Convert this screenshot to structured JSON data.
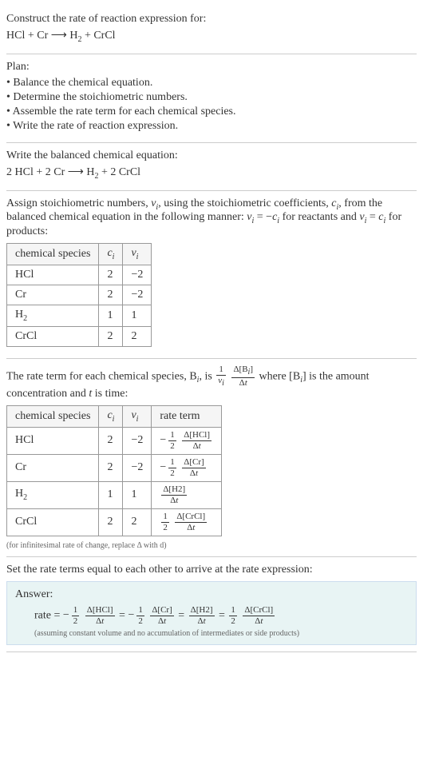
{
  "header": {
    "prompt": "Construct the rate of reaction expression for:",
    "equation_lhs": "HCl + Cr",
    "arrow": "⟶",
    "equation_rhs_h2": "H",
    "equation_rhs_h2_sub": "2",
    "equation_rhs_rest": " + CrCl"
  },
  "plan": {
    "title": "Plan:",
    "items": [
      "• Balance the chemical equation.",
      "• Determine the stoichiometric numbers.",
      "• Assemble the rate term for each chemical species.",
      "• Write the rate of reaction expression."
    ]
  },
  "balanced": {
    "intro": "Write the balanced chemical equation:",
    "lhs": "2 HCl + 2 Cr",
    "arrow": "⟶",
    "rhs_pre": " H",
    "rhs_sub": "2",
    "rhs_post": " + 2 CrCl"
  },
  "stoich": {
    "intro_1": "Assign stoichiometric numbers, ",
    "nu_i": "ν",
    "sub_i": "i",
    "intro_2": ", using the stoichiometric coefficients, ",
    "c_i": "c",
    "intro_3": ", from the balanced chemical equation in the following manner: ",
    "eq1_lhs": "ν",
    "eq1_mid": " = −",
    "eq1_rhs": "c",
    "intro_4": " for reactants and ",
    "eq2_lhs": "ν",
    "eq2_mid": " = ",
    "eq2_rhs": "c",
    "intro_5": " for products:",
    "table": {
      "headers": [
        "chemical species",
        "cᵢ",
        "νᵢ"
      ],
      "rows": [
        {
          "species": "HCl",
          "c": "2",
          "nu": "−2"
        },
        {
          "species": "Cr",
          "c": "2",
          "nu": "−2"
        },
        {
          "species_h": "H",
          "species_sub": "2",
          "c": "1",
          "nu": "1"
        },
        {
          "species": "CrCl",
          "c": "2",
          "nu": "2"
        }
      ]
    }
  },
  "rateterm": {
    "intro_1": "The rate term for each chemical species, B",
    "sub_i": "i",
    "intro_2": ", is ",
    "frac1_num": "1",
    "frac1_den_pre": "ν",
    "frac2_num_pre": "Δ[B",
    "frac2_num_post": "]",
    "frac2_den": "Δt",
    "intro_3": " where [B",
    "intro_4": "] is the amount concentration and ",
    "t_var": "t",
    "intro_5": " is time:",
    "table": {
      "headers": [
        "chemical species",
        "cᵢ",
        "νᵢ",
        "rate term"
      ],
      "rows": [
        {
          "species": "HCl",
          "c": "2",
          "nu": "−2",
          "neg": "−",
          "half_num": "1",
          "half_den": "2",
          "d_num": "Δ[HCl]",
          "d_den": "Δt"
        },
        {
          "species": "Cr",
          "c": "2",
          "nu": "−2",
          "neg": "−",
          "half_num": "1",
          "half_den": "2",
          "d_num": "Δ[Cr]",
          "d_den": "Δt"
        },
        {
          "species_h": "H",
          "species_sub": "2",
          "c": "1",
          "nu": "1",
          "neg": "",
          "half_num": "",
          "half_den": "",
          "d_num": "Δ[H2]",
          "d_den": "Δt"
        },
        {
          "species": "CrCl",
          "c": "2",
          "nu": "2",
          "neg": "",
          "half_num": "1",
          "half_den": "2",
          "d_num": "Δ[CrCl]",
          "d_den": "Δt"
        }
      ]
    },
    "note": "(for infinitesimal rate of change, replace Δ with d)"
  },
  "final": {
    "intro": "Set the rate terms equal to each other to arrive at the rate expression:",
    "answer_label": "Answer:",
    "rate_prefix": "rate = ",
    "terms": {
      "t1_neg": "−",
      "t1_hnum": "1",
      "t1_hden": "2",
      "t1_dnum": "Δ[HCl]",
      "t1_dden": "Δt",
      "eq": " = ",
      "t2_neg": "−",
      "t2_hnum": "1",
      "t2_hden": "2",
      "t2_dnum": "Δ[Cr]",
      "t2_dden": "Δt",
      "t3_dnum": "Δ[H2]",
      "t3_dden": "Δt",
      "t4_hnum": "1",
      "t4_hden": "2",
      "t4_dnum": "Δ[CrCl]",
      "t4_dden": "Δt"
    },
    "note": "(assuming constant volume and no accumulation of intermediates or side products)"
  },
  "chart_data": {
    "type": "table",
    "tables": [
      {
        "title": "stoichiometric numbers",
        "columns": [
          "chemical species",
          "c_i",
          "nu_i"
        ],
        "rows": [
          [
            "HCl",
            2,
            -2
          ],
          [
            "Cr",
            2,
            -2
          ],
          [
            "H2",
            1,
            1
          ],
          [
            "CrCl",
            2,
            2
          ]
        ]
      },
      {
        "title": "rate terms",
        "columns": [
          "chemical species",
          "c_i",
          "nu_i",
          "rate term"
        ],
        "rows": [
          [
            "HCl",
            2,
            -2,
            "-(1/2) Δ[HCl]/Δt"
          ],
          [
            "Cr",
            2,
            -2,
            "-(1/2) Δ[Cr]/Δt"
          ],
          [
            "H2",
            1,
            1,
            "Δ[H2]/Δt"
          ],
          [
            "CrCl",
            2,
            2,
            "(1/2) Δ[CrCl]/Δt"
          ]
        ]
      }
    ],
    "balanced_equation": "2 HCl + 2 Cr ⟶ H2 + 2 CrCl",
    "rate_expression": "rate = -(1/2) Δ[HCl]/Δt = -(1/2) Δ[Cr]/Δt = Δ[H2]/Δt = (1/2) Δ[CrCl]/Δt"
  }
}
